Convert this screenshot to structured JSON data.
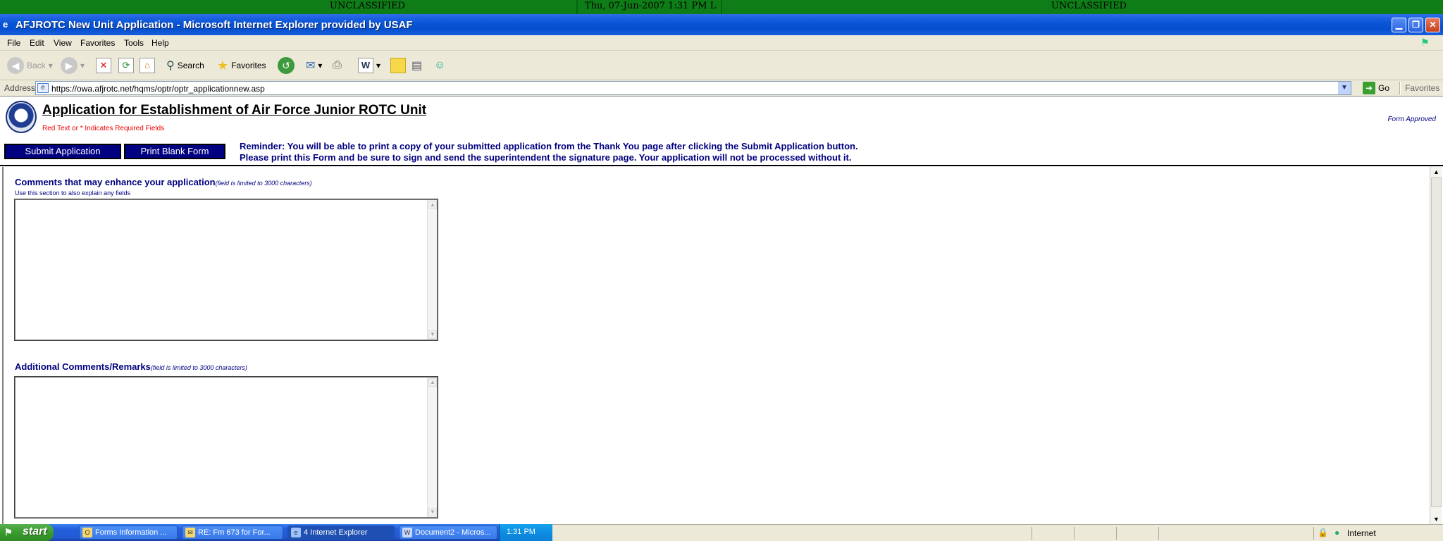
{
  "banner": {
    "left": "UNCLASSIFIED",
    "center": "Thu, 07-Jun-2007 1:31 PM L",
    "right": "UNCLASSIFIED"
  },
  "window": {
    "title": "AFJROTC New Unit Application - Microsoft Internet Explorer provided by USAF"
  },
  "menu": [
    "File",
    "Edit",
    "View",
    "Favorites",
    "Tools",
    "Help"
  ],
  "toolbar": {
    "back": "Back",
    "search": "Search",
    "favorites": "Favorites"
  },
  "address": {
    "label": "Address",
    "url": "https://owa.afjrotc.net/hqms/optr/optr_applicationnew.asp",
    "go": "Go",
    "favorites": "Favorites"
  },
  "page": {
    "title": "Application for Establishment of Air Force Junior ROTC Unit",
    "required_note": "Red Text or * Indicates Required Fields",
    "form_approved": "Form Approved",
    "submit_button": "Submit Application",
    "print_button": "Print Blank Form",
    "reminder_line1": "Reminder: You will be able to print a copy of your submitted application from the Thank You page after clicking the Submit Application button.",
    "reminder_line2": "Please print this Form and be sure to sign and send the superintendent the signature page. Your application will not be processed without it.",
    "comments_label": "Comments that may enhance your application",
    "comments_limit": "(field is limited to 3000 characters)",
    "comments_sub": "Use this section to also explain any fields",
    "comments_value": "",
    "additional_label": "Additional Comments/Remarks",
    "additional_limit": "(field is limited to 3000 characters)",
    "additional_value": ""
  },
  "status": {
    "zone": "Internet"
  },
  "taskbar": {
    "start": "start",
    "tasks": [
      {
        "label": "Forms Information ..."
      },
      {
        "label": "RE: Fm 673 for For..."
      },
      {
        "label": "4 Internet Explorer"
      },
      {
        "label": "Document2 - Micros..."
      }
    ],
    "clock": "1:31 PM"
  }
}
